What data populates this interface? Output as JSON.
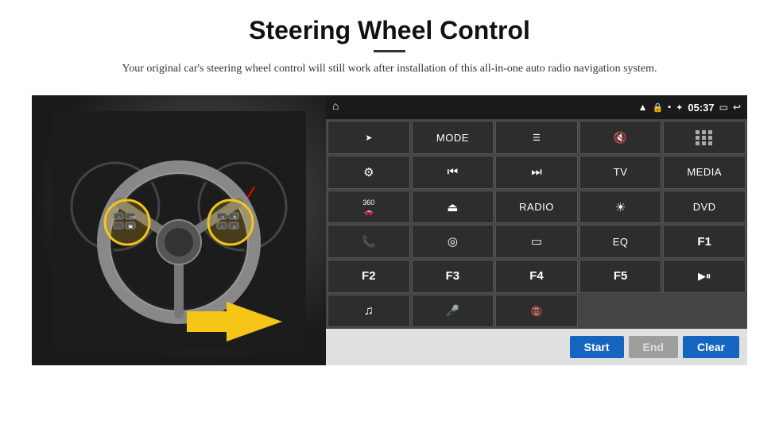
{
  "header": {
    "title": "Steering Wheel Control",
    "subtitle": "Your original car's steering wheel control will still work after installation of this all-in-one auto radio navigation system."
  },
  "status_bar": {
    "time": "05:37",
    "icons": [
      "wifi",
      "lock",
      "sd",
      "bluetooth",
      "screen",
      "back"
    ]
  },
  "button_grid": [
    {
      "id": "home",
      "type": "icon",
      "icon": "home",
      "label": "⌂"
    },
    {
      "id": "mode",
      "type": "text",
      "label": "MODE"
    },
    {
      "id": "menu",
      "type": "icon",
      "icon": "menu",
      "label": "☰"
    },
    {
      "id": "mute",
      "type": "icon",
      "icon": "mute",
      "label": "🔇"
    },
    {
      "id": "apps",
      "type": "icon",
      "icon": "apps",
      "label": "⋯"
    },
    {
      "id": "nav",
      "type": "icon",
      "icon": "nav",
      "label": "➤"
    },
    {
      "id": "rewind",
      "type": "icon",
      "icon": "rewind",
      "label": "⏮"
    },
    {
      "id": "forward",
      "type": "icon",
      "icon": "forward",
      "label": "⏭"
    },
    {
      "id": "tv",
      "type": "text",
      "label": "TV"
    },
    {
      "id": "media",
      "type": "text",
      "label": "MEDIA"
    },
    {
      "id": "360car",
      "type": "icon",
      "icon": "360",
      "label": "360🚗"
    },
    {
      "id": "eject",
      "type": "icon",
      "icon": "eject",
      "label": "⏏"
    },
    {
      "id": "radio",
      "type": "text",
      "label": "RADIO"
    },
    {
      "id": "brightness",
      "type": "icon",
      "icon": "brightness",
      "label": "☀"
    },
    {
      "id": "dvd",
      "type": "text",
      "label": "DVD"
    },
    {
      "id": "phone",
      "type": "icon",
      "icon": "phone",
      "label": "📞"
    },
    {
      "id": "map",
      "type": "icon",
      "icon": "map",
      "label": "◎"
    },
    {
      "id": "screen",
      "type": "icon",
      "icon": "screen",
      "label": "▭"
    },
    {
      "id": "eq",
      "type": "text",
      "label": "EQ"
    },
    {
      "id": "f1",
      "type": "text",
      "label": "F1"
    },
    {
      "id": "f2",
      "type": "text",
      "label": "F2"
    },
    {
      "id": "f3",
      "type": "text",
      "label": "F3"
    },
    {
      "id": "f4",
      "type": "text",
      "label": "F4"
    },
    {
      "id": "f5",
      "type": "text",
      "label": "F5"
    },
    {
      "id": "playpause",
      "type": "icon",
      "icon": "playpause",
      "label": "▶⏸"
    },
    {
      "id": "music",
      "type": "icon",
      "icon": "music",
      "label": "♫"
    },
    {
      "id": "mic",
      "type": "icon",
      "icon": "mic",
      "label": "🎤"
    },
    {
      "id": "hangup",
      "type": "icon",
      "icon": "hangup",
      "label": "📵"
    }
  ],
  "bottom_bar": {
    "start_label": "Start",
    "end_label": "End",
    "clear_label": "Clear"
  }
}
